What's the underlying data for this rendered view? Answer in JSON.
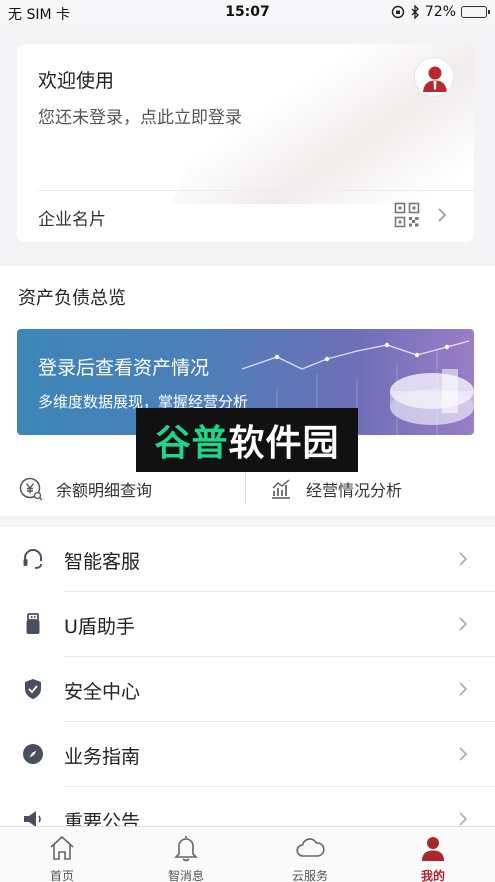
{
  "status_bar": {
    "carrier": "无 SIM 卡",
    "time": "15:07",
    "battery": "72%",
    "battery_level": 0.72
  },
  "profile": {
    "welcome": "欢迎使用",
    "login_tip": "您还未登录，点此立即登录",
    "business_card_label": "企业名片"
  },
  "assets": {
    "section_title": "资产负债总览",
    "banner_title": "登录后查看资产情况",
    "banner_subtitle": "多维度数据展现，掌握经营分析",
    "quick_left": "余额明细查询",
    "quick_right": "经营情况分析"
  },
  "menu": {
    "items": [
      {
        "label": "智能客服",
        "icon": "headset-icon"
      },
      {
        "label": "U盾助手",
        "icon": "usb-key-icon"
      },
      {
        "label": "安全中心",
        "icon": "shield-icon"
      },
      {
        "label": "业务指南",
        "icon": "compass-icon"
      },
      {
        "label": "重要公告",
        "icon": "megaphone-icon"
      }
    ]
  },
  "watermark": {
    "text_green": "谷普",
    "text_white": "软件园"
  },
  "tabbar": {
    "tabs": [
      {
        "label": "首页",
        "icon": "home-icon",
        "active": false
      },
      {
        "label": "智消息",
        "icon": "bell-icon",
        "active": false
      },
      {
        "label": "云服务",
        "icon": "cloud-icon",
        "active": false
      },
      {
        "label": "我的",
        "icon": "person-icon",
        "active": true
      }
    ]
  },
  "colors": {
    "brand_red": "#a8282c",
    "banner_start": "#3d86b7",
    "banner_end": "#9a7ec6"
  }
}
